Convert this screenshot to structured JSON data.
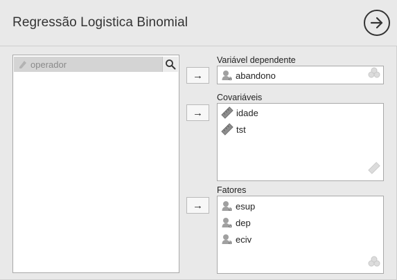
{
  "window": {
    "title": "Regressão Logistica Binomial",
    "go_icon": "arrow-circle-right-icon"
  },
  "source": {
    "items": [
      {
        "label": "operador",
        "icon": "pencil-icon"
      }
    ],
    "search_icon": "search-icon"
  },
  "targets": {
    "dependent": {
      "label": "Variável dependente",
      "button": "→",
      "items": [
        {
          "label": "abandono",
          "icon": "nominal-icon"
        }
      ]
    },
    "covariates": {
      "label": "Covariáveis",
      "button": "→",
      "items": [
        {
          "label": "idade",
          "icon": "ruler-icon"
        },
        {
          "label": "tst",
          "icon": "ruler-icon"
        }
      ]
    },
    "factors": {
      "label": "Fatores",
      "button": "→",
      "items": [
        {
          "label": "esup",
          "icon": "nominal-icon"
        },
        {
          "label": "dep",
          "icon": "nominal-icon"
        },
        {
          "label": "eciv",
          "icon": "nominal-icon"
        }
      ]
    }
  },
  "colors": {
    "background": "#e9e9e9",
    "panel": "#ffffff",
    "selected": "#d4d4d4"
  }
}
